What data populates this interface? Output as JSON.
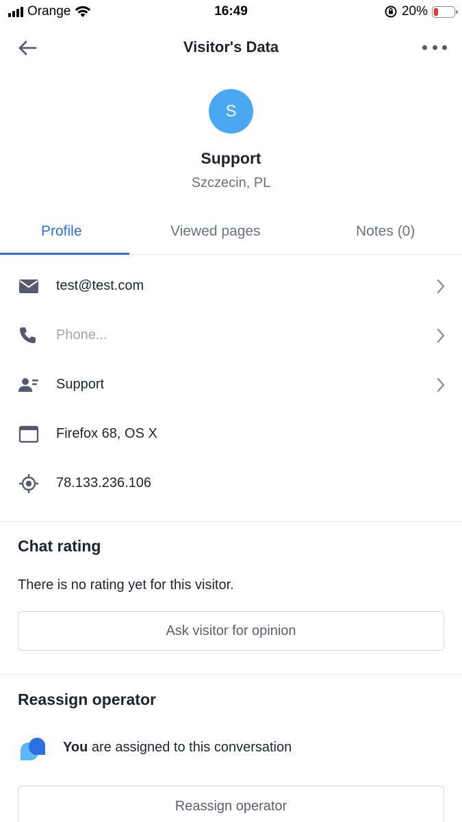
{
  "status_bar": {
    "carrier": "Orange",
    "time": "16:49",
    "battery": "20%",
    "battery_level": 0.2,
    "battery_color": "#e8392c"
  },
  "header": {
    "title": "Visitor's Data",
    "back_icon": "arrow-left-icon",
    "more_icon": "more-horizontal-icon"
  },
  "profile": {
    "avatar_initial": "S",
    "avatar_color": "#4aa8f2",
    "name": "Support",
    "location": "Szczecin, PL"
  },
  "tabs": [
    {
      "label": "Profile",
      "active": true
    },
    {
      "label": "Viewed pages",
      "active": false
    },
    {
      "label": "Notes (0)",
      "active": false
    }
  ],
  "accent_color": "#2b6fe0",
  "info_rows": [
    {
      "icon": "mail-icon",
      "text": "test@test.com",
      "chevron": true
    },
    {
      "icon": "phone-icon",
      "placeholder": "Phone...",
      "chevron": true
    },
    {
      "icon": "contact-card-icon",
      "text": "Support",
      "chevron": true
    },
    {
      "icon": "browser-window-icon",
      "text": "Firefox 68, OS X",
      "chevron": false
    },
    {
      "icon": "location-target-icon",
      "text": "78.133.236.106",
      "chevron": false
    }
  ],
  "chat_rating": {
    "title": "Chat rating",
    "text": "There is no rating yet for this visitor.",
    "button_label": "Ask visitor for opinion"
  },
  "reassign": {
    "title": "Reassign operator",
    "assigned_you": "You",
    "assigned_rest": " are assigned to this conversation",
    "button_label": "Reassign operator"
  }
}
